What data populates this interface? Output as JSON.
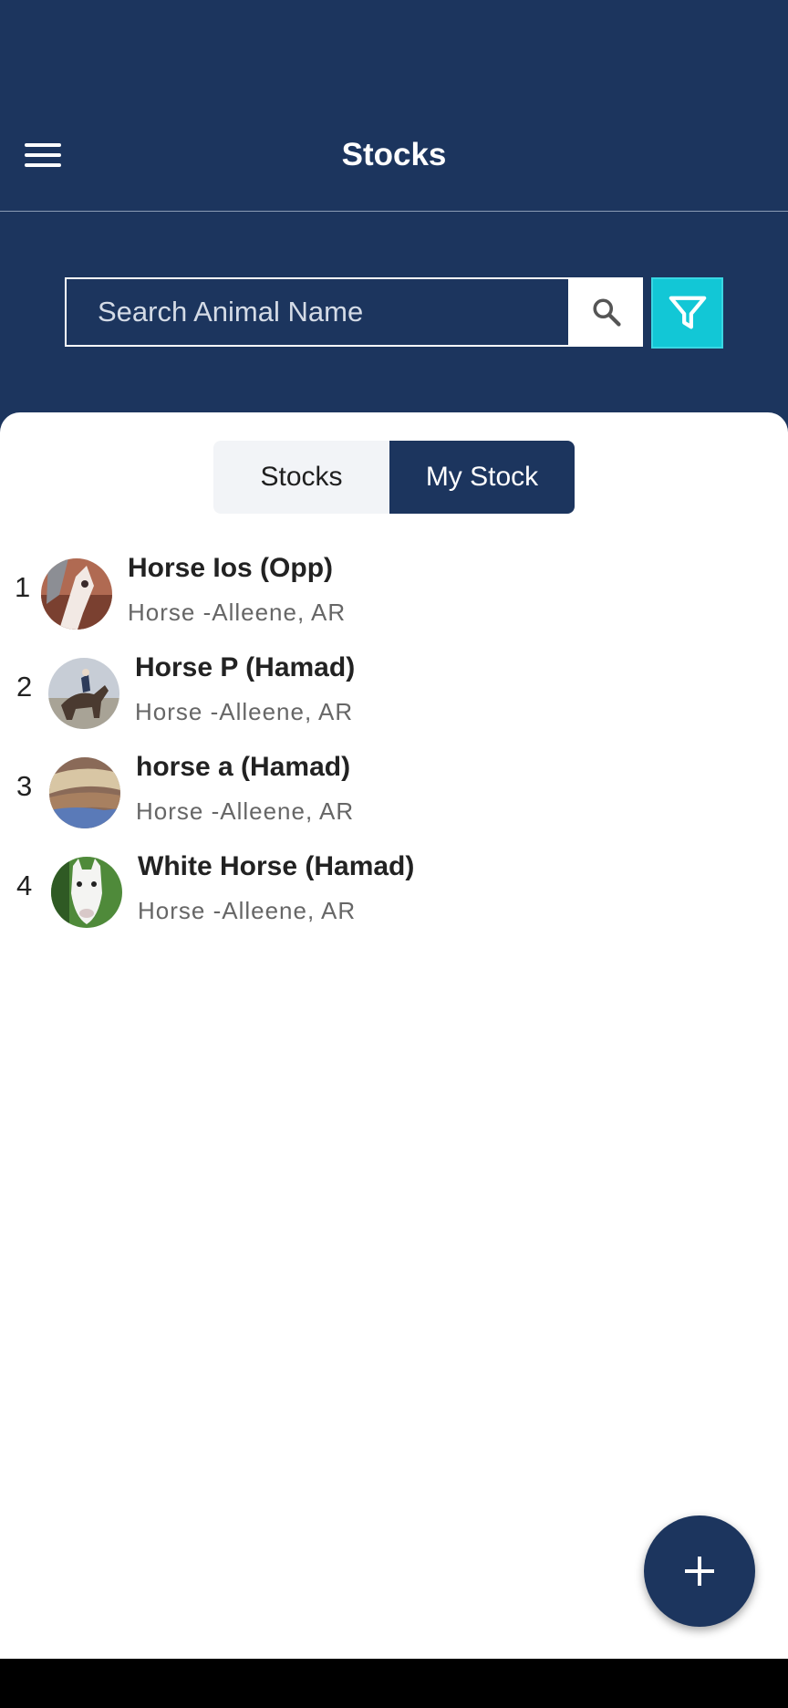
{
  "header": {
    "title": "Stocks",
    "menu_icon": "hamburger-menu-icon"
  },
  "search": {
    "placeholder": "Search Animal Name",
    "search_icon": "magnifier-icon",
    "filter_icon": "funnel-filter-icon"
  },
  "tabs": [
    {
      "label": "Stocks",
      "active": false
    },
    {
      "label": "My Stock",
      "active": true
    }
  ],
  "animals": [
    {
      "index": "1",
      "name": "Horse Ios (Opp)",
      "subtitle": "Horse -Alleene, AR"
    },
    {
      "index": "2",
      "name": "Horse P (Hamad)",
      "subtitle": "Horse -Alleene, AR"
    },
    {
      "index": "3",
      "name": "horse a (Hamad)",
      "subtitle": "Horse -Alleene, AR"
    },
    {
      "index": "4",
      "name": "White Horse (Hamad)",
      "subtitle": "Horse -Alleene, AR"
    }
  ],
  "fab": {
    "icon": "plus-icon"
  },
  "colors": {
    "primary": "#1c355e",
    "accent": "#12c7d6",
    "background": "#ffffff"
  }
}
